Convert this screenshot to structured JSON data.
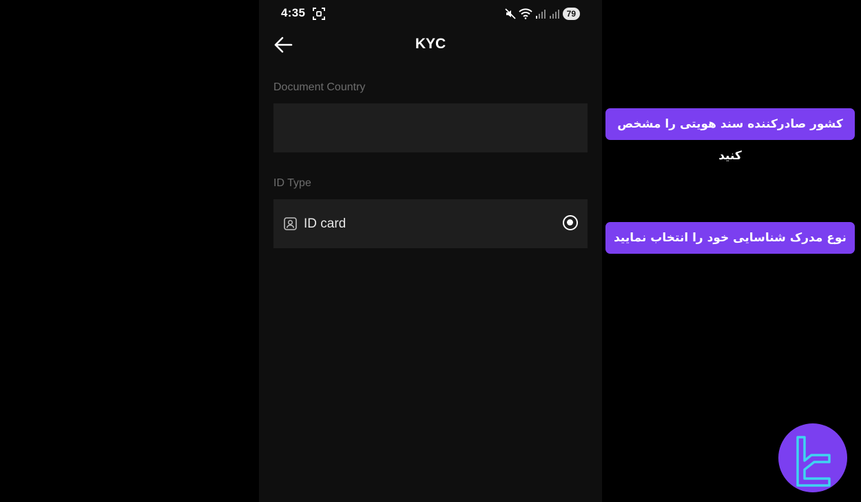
{
  "status_bar": {
    "time": "4:35",
    "battery": "79",
    "icons": [
      "screenshot-icon",
      "mute-icon",
      "wifi-icon",
      "signal-icon",
      "signal-icon"
    ]
  },
  "header": {
    "title": "KYC",
    "back_icon": "arrow-left-icon"
  },
  "form": {
    "document_country": {
      "label": "Document Country",
      "value": ""
    },
    "id_type": {
      "label": "ID Type",
      "options": [
        {
          "label": "ID card",
          "icon": "id-badge-icon",
          "selected": true
        }
      ]
    }
  },
  "annotations": {
    "callout_country": "کشور صادرکننده سند هویتی را مشخص کنید",
    "callout_id_type": "نوع مدرک شناسایی خود را انتخاب نمایید"
  },
  "colors": {
    "accent": "#7b3ff0",
    "logo_line": "#3fd4f0",
    "panel": "#1e1e1e",
    "background": "#0f0f0f"
  }
}
